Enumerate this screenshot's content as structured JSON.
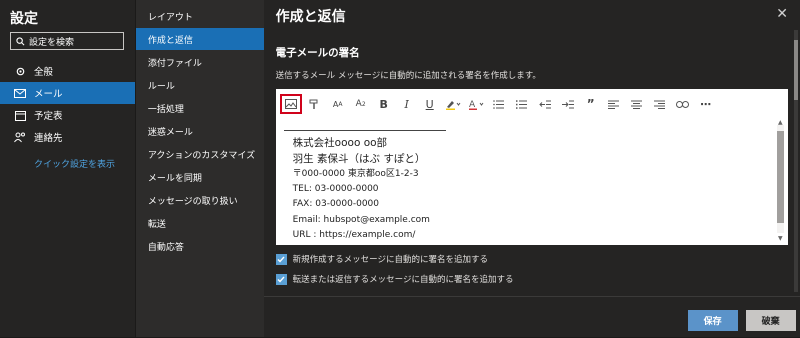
{
  "nav": {
    "title": "設定",
    "search_label": "設定を検索",
    "items": [
      {
        "label": "全般",
        "icon": "gear-icon"
      },
      {
        "label": "メール",
        "icon": "mail-icon"
      },
      {
        "label": "予定表",
        "icon": "calendar-icon"
      },
      {
        "label": "連絡先",
        "icon": "people-icon"
      }
    ],
    "quick_settings": "クイック設定を表示"
  },
  "sub": {
    "items": [
      "レイアウト",
      "作成と返信",
      "添付ファイル",
      "ルール",
      "一括処理",
      "迷惑メール",
      "アクションのカスタマイズ",
      "メールを同期",
      "メッセージの取り扱い",
      "転送",
      "自動応答"
    ],
    "active_index": 1
  },
  "main": {
    "title": "作成と返信",
    "section_title": "電子メールの署名",
    "section_desc": "送信するメール メッセージに自動的に追加される署名を作成します。",
    "toolbar_icons": [
      "insert-image-icon",
      "format-painter-icon",
      "font-size-icon",
      "superscript-icon",
      "bold-icon",
      "italic-icon",
      "underline-icon",
      "highlight-icon",
      "font-color-icon",
      "bullets-icon",
      "numbering-icon",
      "decrease-indent-icon",
      "increase-indent-icon",
      "quote-icon",
      "align-left-icon",
      "align-center-icon",
      "align-right-icon",
      "link-icon",
      "more-icon"
    ],
    "signature": {
      "company": "株式会社oooo oo部",
      "name": "羽生 素保斗（はぶ すぽと）",
      "address": "〒000-0000 東京都oo区1-2-3",
      "tel": "TEL: 03-0000-0000",
      "fax": "FAX: 03-0000-0000",
      "email": "Email: hubspot@example.com",
      "url": "URL : https://example.com/"
    },
    "checkbox_new": "新規作成するメッセージに自動的に署名を追加する",
    "checkbox_reply": "転送または返信するメッセージに自動的に署名を追加する",
    "save": "保存",
    "discard": "破棄",
    "close": "✕"
  },
  "colors": {
    "accent": "#1a6fb5",
    "highlight_box": "#d0021b"
  }
}
